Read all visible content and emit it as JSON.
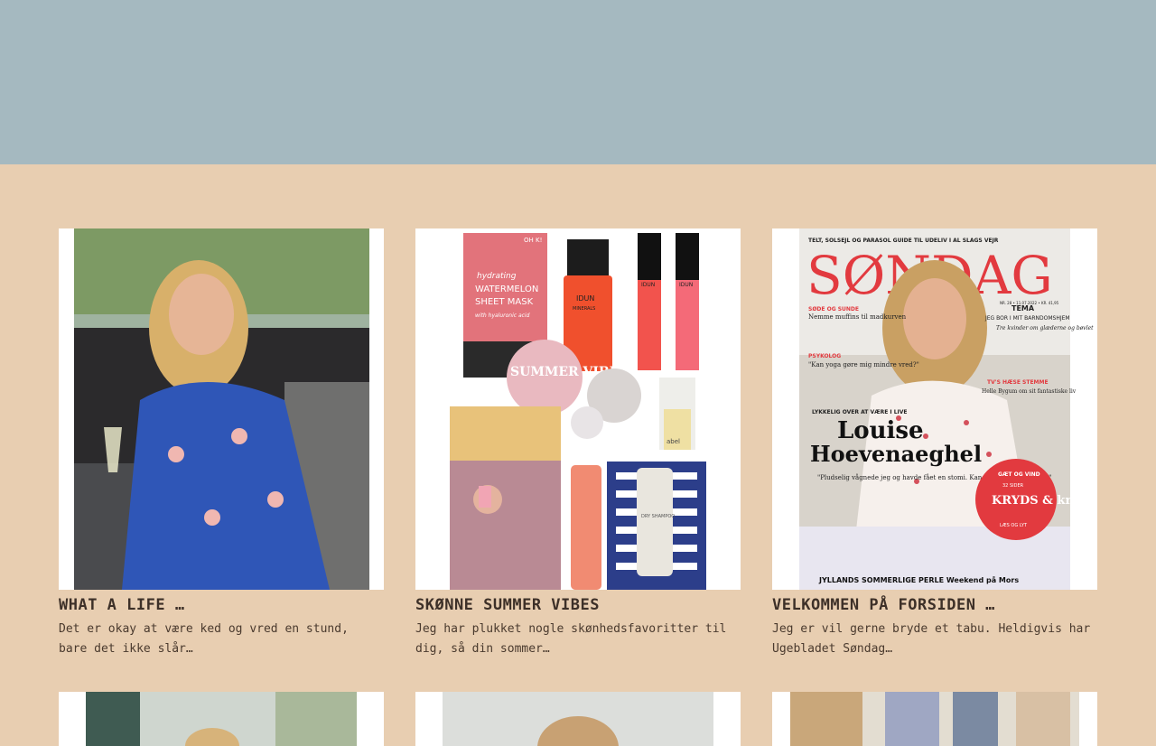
{
  "posts": [
    {
      "title": "WHAT A LIFE …",
      "excerpt": "Det er okay at være ked og vred en stund, bare det ikke slår…",
      "image": "woman-with-wine-photo"
    },
    {
      "title": "SKØNNE SUMMER VIBES",
      "excerpt": "Jeg har plukket nogle skønhedsfavoritter til dig, så din sommer…",
      "image": "beauty-products-collage",
      "image_text": {
        "mask_brand": "OH K!",
        "mask_line1": "hydrating",
        "mask_line2": "WATERMELON",
        "mask_line3": "SHEET MASK",
        "mask_line4": "with hyaluronic acid",
        "polish_brand": "IDUN",
        "polish_sub": "MINERALS",
        "gloss1": "IDUN",
        "gloss2": "IDUN",
        "badge": "SUMMER VIBES",
        "bottle": "abel",
        "shampoo": "DRY SHAMPOO"
      }
    },
    {
      "title": "VELKOMMEN PÅ FORSIDEN …",
      "excerpt": "Jeg er vil gerne bryde et tabu. Heldigvis har Ugebladet Søndag…",
      "image": "magazine-cover-photo",
      "image_text": {
        "topline": "TELT, SOLSEJL OG PARASOL GUIDE TIL UDELIV I AL SLAGS VEJR",
        "masthead": "SØNDAG",
        "issue": "NR. 28 • 11.07.2022 • KR. 41,95",
        "k1": "SØDE OG SUNDE",
        "k1b": "Nemme muffins til madkurven",
        "k2": "PSYKOLOG",
        "k2b": "\"Kan yoga gøre mig mindre vred?\"",
        "k3": "TEMA",
        "k3b": "JEG BOR I MIT BARNDOMSHJEM",
        "k3c": "Tre kvinder om glæderne og bøvlet",
        "k4": "TV'S HÆSE STEMME",
        "k4b": "Helle Bygum om sit fantastiske liv",
        "k5": "LYKKELIG OVER AT VÆRE I LIVE",
        "name1": "Louise",
        "name2": "Hoevenaeghel",
        "quote": "\"Pludselig vågnede jeg og havde fået en stomi. Kan jeg leve med det …?\"",
        "badge1": "GÆT OG VIND",
        "badge2": "32 SIDER",
        "badge3": "KRYDS & krimi",
        "badge4": "LÆS OG LYT",
        "bottom": "JYLLANDS SOMMERLIGE PERLE Weekend på Mors"
      }
    }
  ],
  "row2": [
    {
      "image": "portrait-photo"
    },
    {
      "image": "portrait-photo"
    },
    {
      "image": "interior-photo"
    }
  ]
}
